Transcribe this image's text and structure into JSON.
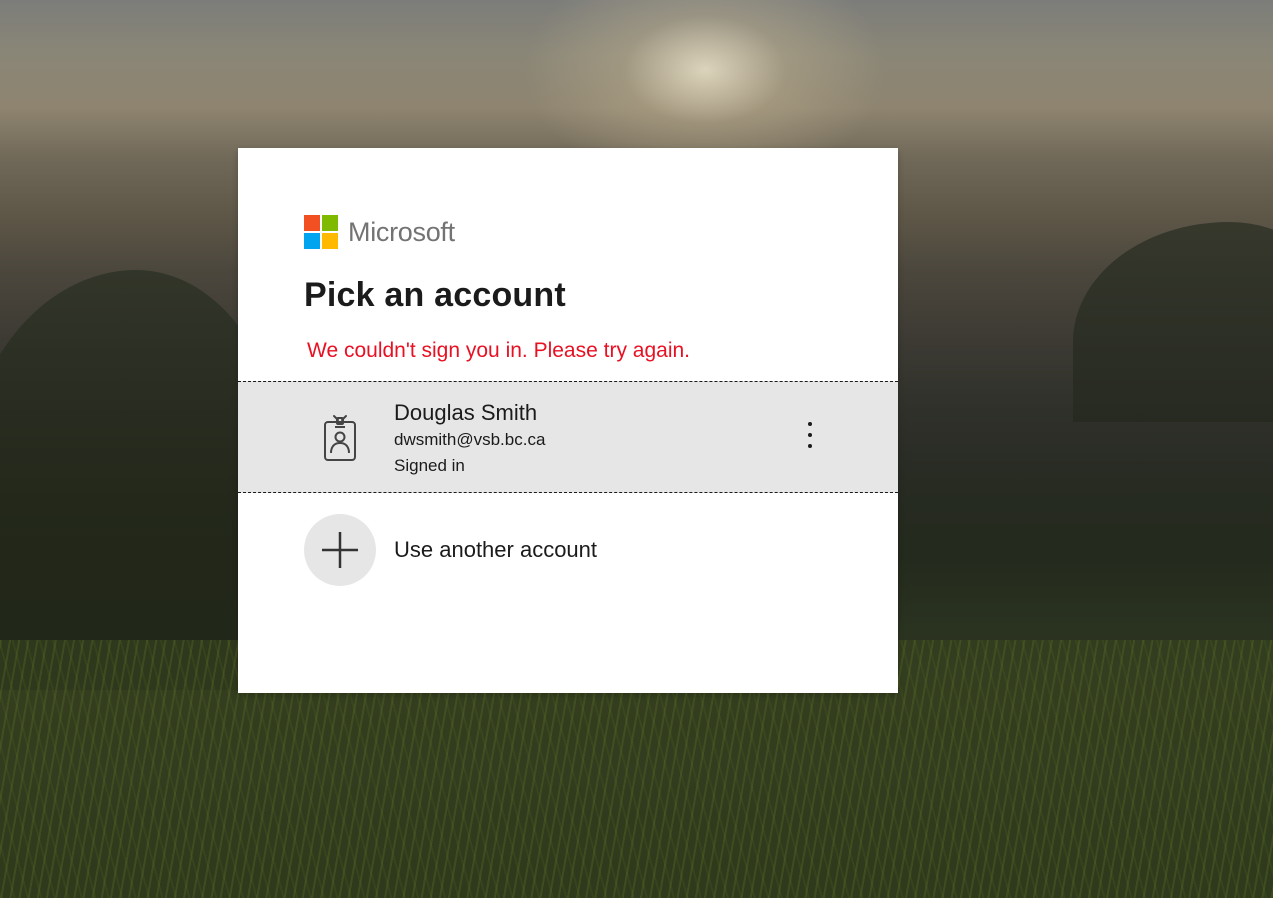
{
  "brand": {
    "name": "Microsoft",
    "logo_colors": [
      "#f25022",
      "#7fba00",
      "#00a4ef",
      "#ffb900"
    ]
  },
  "heading": "Pick an account",
  "error_message": "We couldn't sign you in. Please try again.",
  "accounts": [
    {
      "name": "Douglas Smith",
      "email": "dwsmith@vsb.bc.ca",
      "status": "Signed in",
      "icon": "work-badge-icon",
      "options_icon": "more-options-icon"
    }
  ],
  "other_account": {
    "label": "Use another account",
    "icon": "plus-icon"
  },
  "colors": {
    "error": "#e81123",
    "tile_background": "#e6e6e6",
    "text": "#1b1b1b",
    "logo_text": "#737373"
  }
}
